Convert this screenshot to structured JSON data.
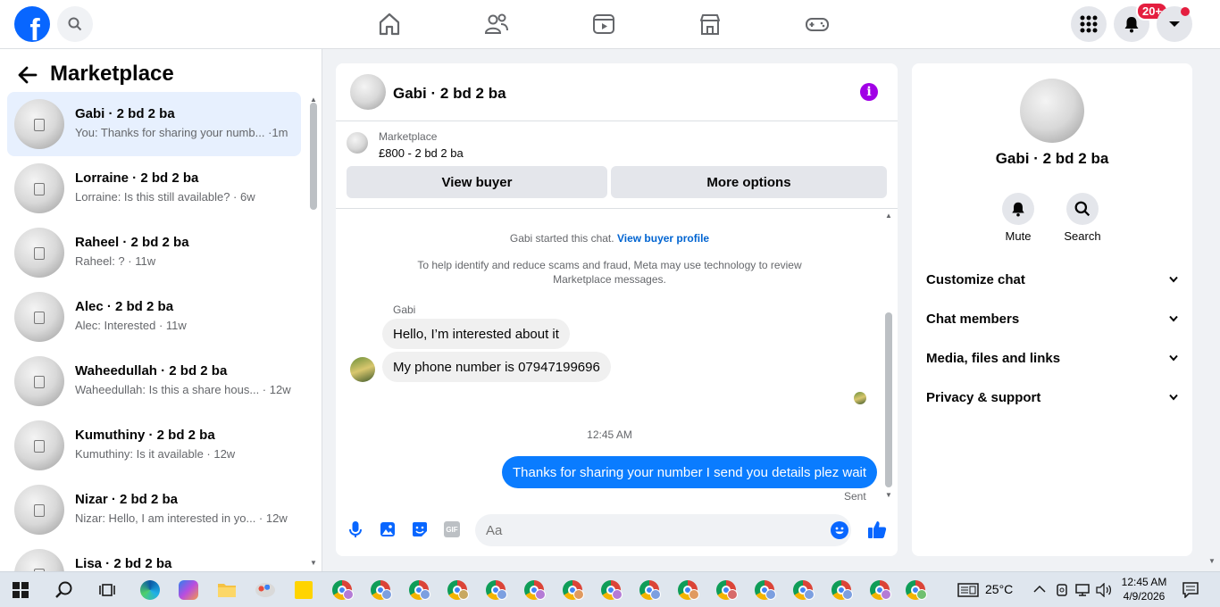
{
  "topbar": {
    "logo_letter": "f",
    "notification_badge": "20+",
    "colors": {
      "brand": "#0866ff",
      "badge": "#e41e3f"
    },
    "nav_icons": [
      "home-icon",
      "friends-icon",
      "video-icon",
      "marketplace-icon",
      "gaming-icon"
    ],
    "right_icons": [
      "menu-grid-icon",
      "bell-icon",
      "account-caret-icon"
    ]
  },
  "sidebar": {
    "title": "Marketplace",
    "conversations": [
      {
        "name": "Gabi · 2 bd 2 ba",
        "preview": "You: Thanks for sharing your numb... ·1m",
        "active": true
      },
      {
        "name": "Lorraine · 2 bd 2 ba",
        "preview": "Lorraine: Is this still available? · 6w"
      },
      {
        "name": "Raheel · 2 bd 2 ba",
        "preview": "Raheel: ? · 11w"
      },
      {
        "name": "Alec · 2 bd 2 ba",
        "preview": "Alec: Interested · 11w"
      },
      {
        "name": "Waheedullah · 2 bd 2 ba",
        "preview": "Waheedullah: Is this a share hous... · 12w"
      },
      {
        "name": "Kumuthiny · 2 bd 2 ba",
        "preview": "Kumuthiny: Is it available · 12w"
      },
      {
        "name": "Nizar · 2 bd 2 ba",
        "preview": "Nizar: Hello, I am interested in yo...  · 12w"
      },
      {
        "name": "Lisa · 2 bd 2 ba",
        "preview": ""
      }
    ]
  },
  "chat": {
    "title": "Gabi · 2 bd 2 ba",
    "listing": {
      "source": "Marketplace",
      "price_title": "£800 - 2 bd 2 ba"
    },
    "buttons": {
      "view_buyer": "View buyer",
      "more_options": "More options"
    },
    "started_text": "Gabi started this chat.",
    "started_link": "View buyer profile",
    "safety_notice": "To help identify and reduce scams and fraud, Meta may use technology to review Marketplace messages.",
    "sender_name": "Gabi",
    "incoming": [
      "Hello, I’m interested about it",
      "My phone number is 07947199696"
    ],
    "time_separator": "12:45 AM",
    "outgoing": "Thanks for sharing your number I send you details plez wait",
    "status": "Sent",
    "composer_placeholder": "Aa",
    "composer_icons": [
      "microphone-icon",
      "photo-icon",
      "sticker-icon",
      "gif-icon",
      "emoji-icon",
      "thumbs-up-icon"
    ],
    "gif_label": "GIF"
  },
  "details": {
    "name": "Gabi · 2 bd 2 ba",
    "actions": [
      {
        "label": "Mute",
        "icon": "bell-icon"
      },
      {
        "label": "Search",
        "icon": "search-icon"
      }
    ],
    "sections": [
      "Customize chat",
      "Chat members",
      "Media, files and links",
      "Privacy & support"
    ]
  },
  "taskbar": {
    "weather": "25°C",
    "time": "12:45 AM",
    "date": "4/9/2026",
    "chrome_profiles": 16
  }
}
